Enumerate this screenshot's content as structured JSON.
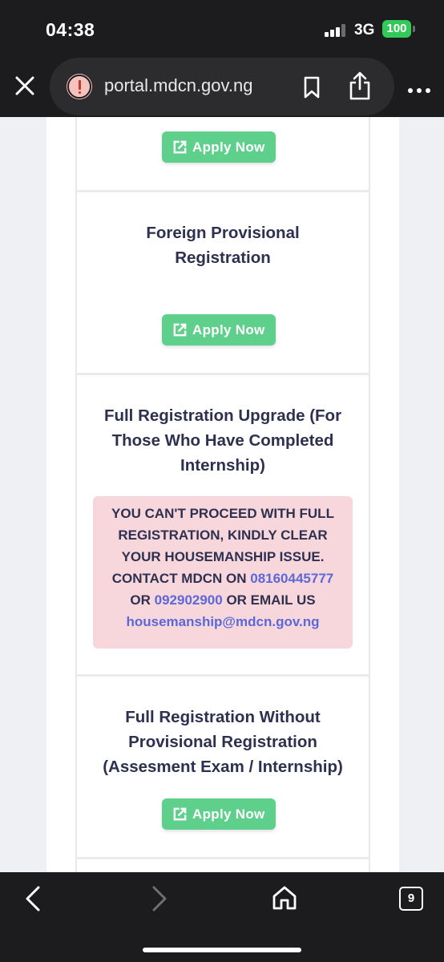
{
  "status_bar": {
    "time": "04:38",
    "network": "3G",
    "battery": "100"
  },
  "browser": {
    "url": "portal.mdcn.gov.ng",
    "icons": {
      "close": "close-icon",
      "warning": "warning-icon",
      "bookmark": "bookmark-icon",
      "share": "share-icon",
      "more": "more-icon"
    }
  },
  "cards": [
    {
      "title_lines": [],
      "button_label": "Apply Now"
    },
    {
      "title_lines": [
        "Foreign Provisional",
        "Registration"
      ],
      "button_label": "Apply Now"
    },
    {
      "title_lines": [
        "Full Registration Upgrade (For",
        "Those Who Have Completed",
        "Internship)"
      ],
      "alert": {
        "line1": "YOU CAN'T PROCEED WITH FULL",
        "line2": "REGISTRATION, KINDLY CLEAR",
        "line3": "YOUR HOUSEMANSHIP ISSUE.",
        "line4_prefix": "CONTACT MDCN ON ",
        "phone1": "08160445777",
        "line5_prefix": "OR ",
        "phone2": "092902900",
        "line5_suffix": " OR EMAIL US",
        "email": "housemanship@mdcn.gov.ng"
      }
    },
    {
      "title_lines": [
        "Full Registration Without",
        "Provisional Registration",
        "(Assesment Exam / Internship)"
      ],
      "button_label": "Apply Now"
    }
  ],
  "colors": {
    "button_green": "#5fcf8c",
    "title_navy": "#2e3050",
    "alert_bg": "#f8d7dc",
    "link_blue": "#5a68d8",
    "battery_green": "#34c759"
  },
  "toolbar": {
    "tab_count": "9",
    "icons": {
      "back": "chevron-left-icon",
      "forward": "chevron-right-icon",
      "home": "home-icon",
      "tabs": "tabs-icon"
    }
  }
}
